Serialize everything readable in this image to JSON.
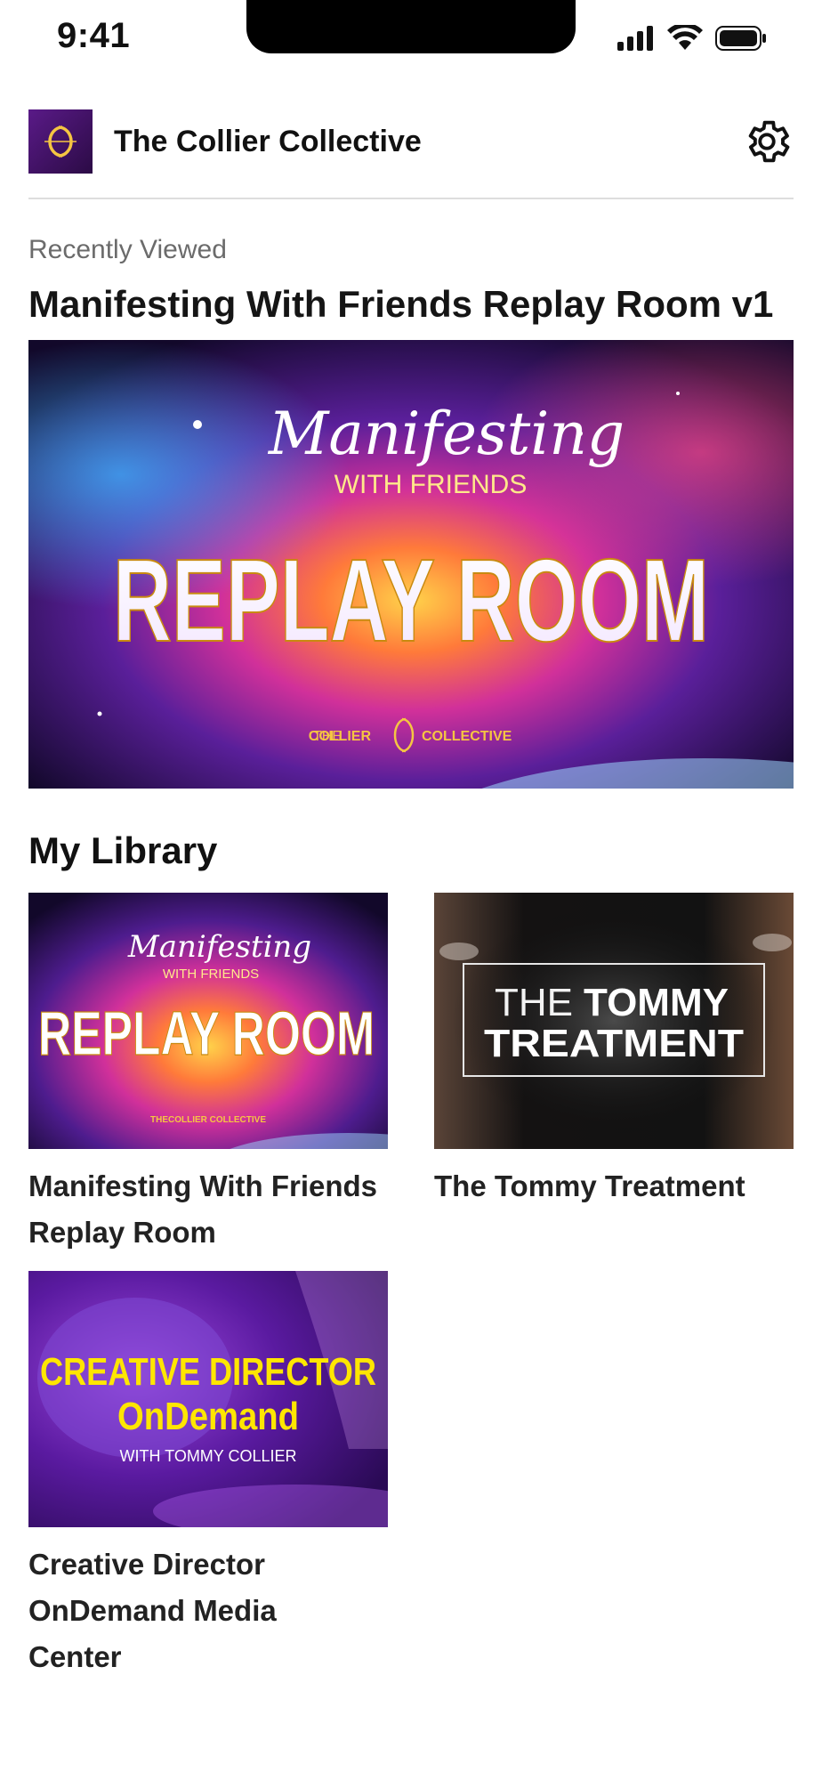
{
  "status_bar": {
    "time": "9:41"
  },
  "header": {
    "title": "The Collier Collective",
    "logo_icon": "double-c-logo-icon",
    "settings_icon": "gear-icon"
  },
  "recently_viewed": {
    "label": "Recently Viewed",
    "title": "Manifesting With Friends Replay Room v1",
    "artwork": {
      "script": "Manifesting",
      "sub": "WITH FRIENDS",
      "headline": "REPLAY ROOM",
      "brand_left": "THE",
      "brand_mid": "COLLIER",
      "brand_right": "COLLECTIVE"
    }
  },
  "library": {
    "title": "My Library",
    "items": [
      {
        "title": "Manifesting With Friends Replay Room",
        "artwork": {
          "script": "Manifesting",
          "sub": "WITH FRIENDS",
          "headline": "REPLAY ROOM",
          "brand": "THECOLLIER COLLECTIVE"
        }
      },
      {
        "title": "The Tommy Treatment",
        "artwork": {
          "line1_light": "THE",
          "line1_bold": "TOMMY",
          "line2": "TREATMENT"
        }
      },
      {
        "title": "Creative Director OnDemand Media Center",
        "artwork": {
          "line1": "CREATIVE DIRECTOR",
          "line2": "OnDemand",
          "line3": "WITH TOMMY COLLIER"
        }
      }
    ]
  },
  "colors": {
    "accent_gold": "#f5c542",
    "deep_purple": "#3a0f63",
    "creative_yellow": "#ffe600"
  }
}
